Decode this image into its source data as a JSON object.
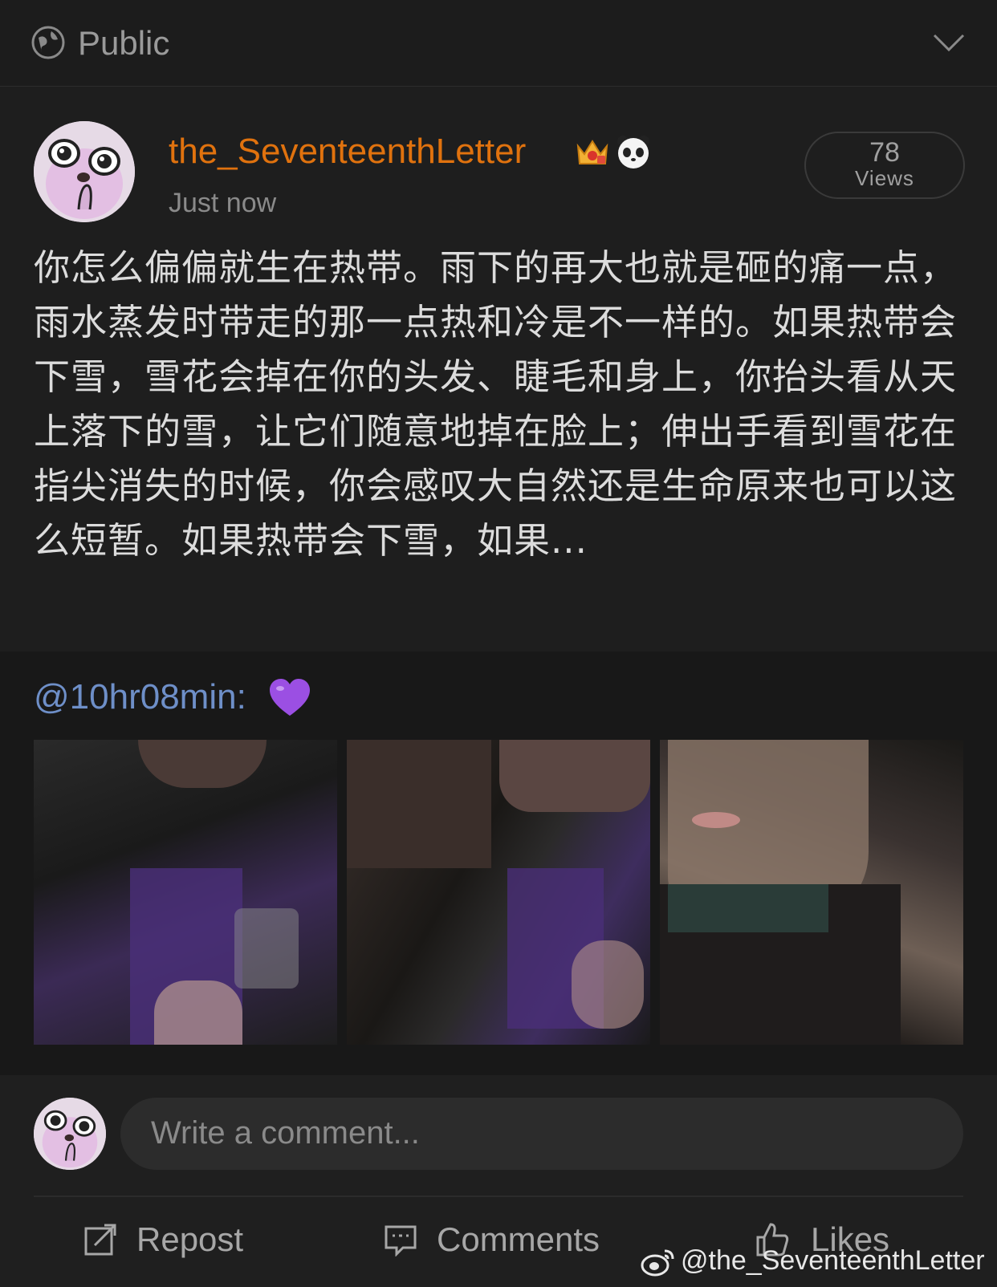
{
  "header": {
    "visibility": "Public"
  },
  "post": {
    "username": "the_SeventeenthLetter",
    "timestamp": "Just now",
    "views_count": "78",
    "views_label": "Views",
    "body": "你怎么偏偏就生在热带。雨下的再大也就是砸的痛一点，雨水蒸发时带走的那一点热和冷是不一样的。如果热带会下雪，雪花会掉在你的头发、睫毛和身上，你抬头看从天上落下的雪，让它们随意地掉在脸上；伸出手看到雪花在指尖消失的时候，你会感叹大自然还是生命原来也可以这么短暂。如果热带会下雪，如果..."
  },
  "repost": {
    "mention": "@10hr08min:"
  },
  "comment": {
    "placeholder": "Write a comment..."
  },
  "actions": {
    "repost": "Repost",
    "comments": "Comments",
    "likes": "Likes"
  },
  "watermark": "@the_SeventeenthLetter",
  "colors": {
    "username": "#e0720e",
    "mention": "#6e8fc8",
    "background": "#1f1f1f"
  }
}
